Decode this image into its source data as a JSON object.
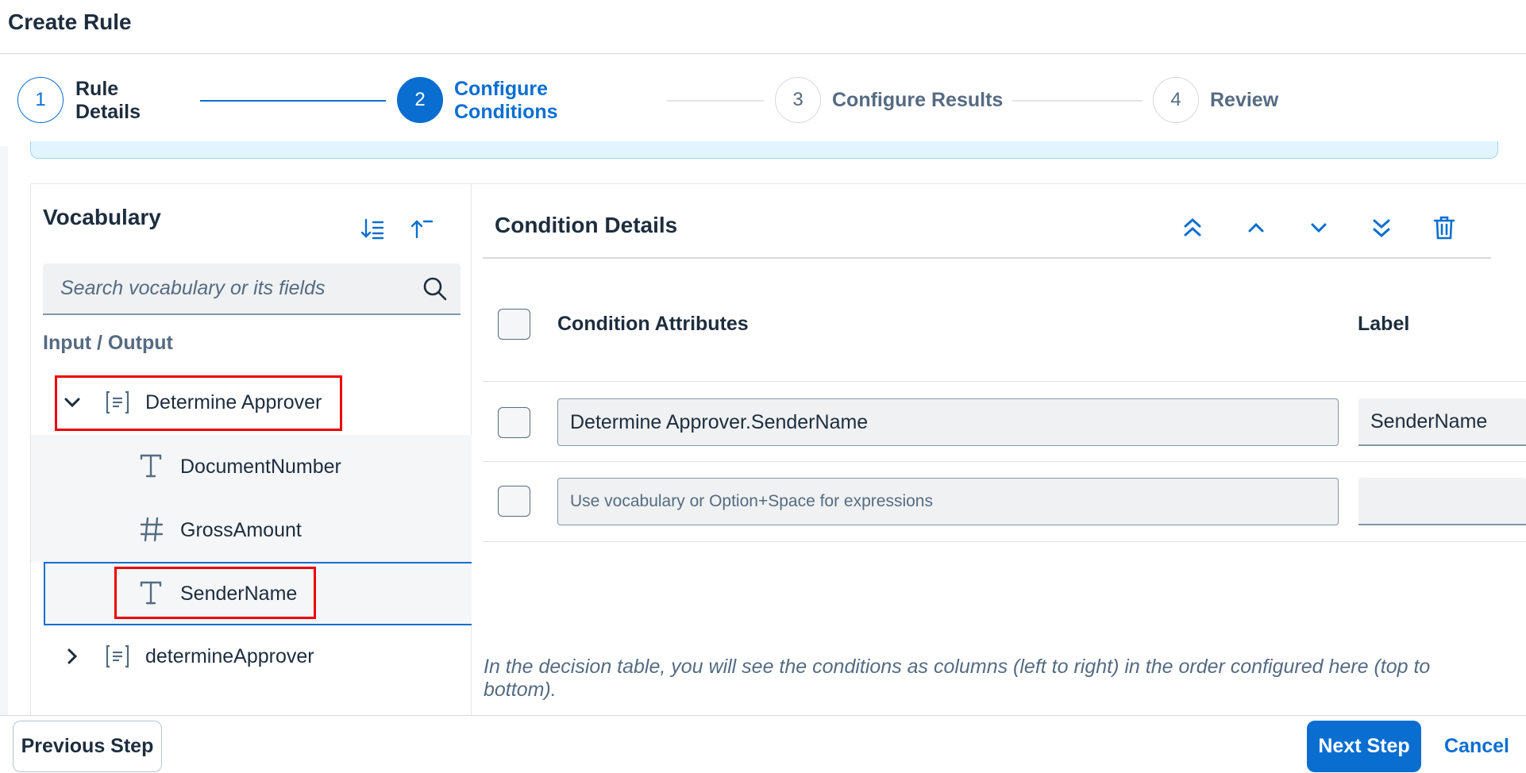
{
  "title": "Create Rule",
  "wizard": {
    "steps": [
      {
        "number": "1",
        "label_line1": "Rule",
        "label_line2": "Details"
      },
      {
        "number": "2",
        "label_line1": "Configure",
        "label_line2": "Conditions"
      },
      {
        "number": "3",
        "label": "Configure Results"
      },
      {
        "number": "4",
        "label": "Review"
      }
    ],
    "active_step": 2
  },
  "vocabulary": {
    "title": "Vocabulary",
    "sort_icon": "sort-descending-icon",
    "collapse_icon": "collapse-all-icon",
    "search_placeholder": "Search vocabulary or its fields",
    "section_label": "Input / Output",
    "tree": [
      {
        "label": "Determine Approver",
        "icon": "structure-icon",
        "expanded": true
      },
      {
        "label": "DocumentNumber",
        "icon": "text-type-icon"
      },
      {
        "label": "GrossAmount",
        "icon": "number-type-icon"
      },
      {
        "label": "SenderName",
        "icon": "text-type-icon",
        "selected": true
      },
      {
        "label": "determineApprover",
        "icon": "structure-icon",
        "expanded": false
      }
    ]
  },
  "condition_details": {
    "title": "Condition Details",
    "toolbar": [
      "move-to-top-icon",
      "move-up-icon",
      "move-down-icon",
      "move-to-bottom-icon",
      "delete-icon"
    ],
    "columns": {
      "attributes": "Condition Attributes",
      "label": "Label"
    },
    "rows": [
      {
        "attribute": "Determine Approver.SenderName",
        "label": "SenderName"
      },
      {
        "attribute_placeholder": "Use vocabulary or Option+Space for expressions",
        "label": ""
      }
    ],
    "hint": "In the decision table, you will see the conditions as columns (left to right) in the order configured here (top to bottom)."
  },
  "footer": {
    "previous": "Previous Step",
    "next": "Next Step",
    "cancel": "Cancel"
  },
  "colors": {
    "accent": "#0a6ed1",
    "highlight_box": "#ee0000"
  }
}
